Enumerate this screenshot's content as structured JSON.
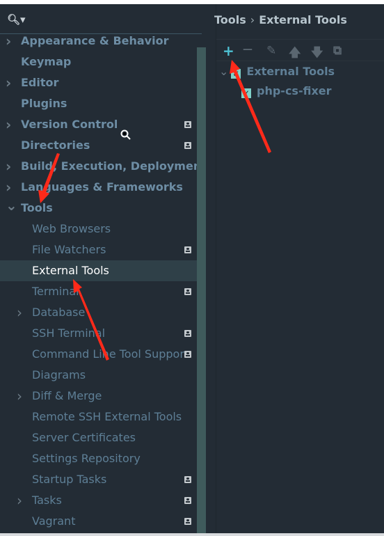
{
  "search": {
    "icon": "search-icon"
  },
  "sidebar": {
    "items": [
      {
        "label": "Appearance & Behavior",
        "level": 0,
        "expandable": true
      },
      {
        "label": "Keymap",
        "level": 0
      },
      {
        "label": "Editor",
        "level": 0,
        "expandable": true
      },
      {
        "label": "Plugins",
        "level": 0
      },
      {
        "label": "Version Control",
        "level": 0,
        "expandable": true,
        "badge": true
      },
      {
        "label": "Directories",
        "level": 0,
        "badge": true
      },
      {
        "label": "Build, Execution, Deployment",
        "level": 0,
        "expandable": true
      },
      {
        "label": "Languages & Frameworks",
        "level": 0,
        "expandable": true
      },
      {
        "label": "Tools",
        "level": 0,
        "expanded": true
      },
      {
        "label": "Web Browsers",
        "level": 1
      },
      {
        "label": "File Watchers",
        "level": 1,
        "badge": true
      },
      {
        "label": "External Tools",
        "level": 1,
        "selected": true
      },
      {
        "label": "Terminal",
        "level": 1,
        "badge": true
      },
      {
        "label": "Database",
        "level": 1,
        "expandable": true
      },
      {
        "label": "SSH Terminal",
        "level": 1,
        "badge": true
      },
      {
        "label": "Command Line Tool Suppor",
        "level": 1,
        "badge": true
      },
      {
        "label": "Diagrams",
        "level": 1
      },
      {
        "label": "Diff & Merge",
        "level": 1,
        "expandable": true
      },
      {
        "label": "Remote SSH External Tools",
        "level": 1
      },
      {
        "label": "Server Certificates",
        "level": 1
      },
      {
        "label": "Settings Repository",
        "level": 1
      },
      {
        "label": "Startup Tasks",
        "level": 1,
        "badge": true
      },
      {
        "label": "Tasks",
        "level": 1,
        "expandable": true,
        "badge": true
      },
      {
        "label": "Vagrant",
        "level": 1,
        "badge": true
      }
    ]
  },
  "breadcrumb": {
    "parent": "Tools",
    "separator": "›",
    "current": "External Tools"
  },
  "toolbar": {
    "add": "+",
    "remove": "—",
    "edit": "✎",
    "up": "🡅",
    "down": "🡇",
    "copy": "⧉"
  },
  "tree": {
    "group": "External Tools",
    "group_check": "✓",
    "item": "php-cs-fixer",
    "item_check": "✓",
    "expand": "⌄"
  },
  "colors": {
    "accent": "#4ec2d4",
    "annotation": "#ff2a1a",
    "selection": "#2f4048"
  }
}
